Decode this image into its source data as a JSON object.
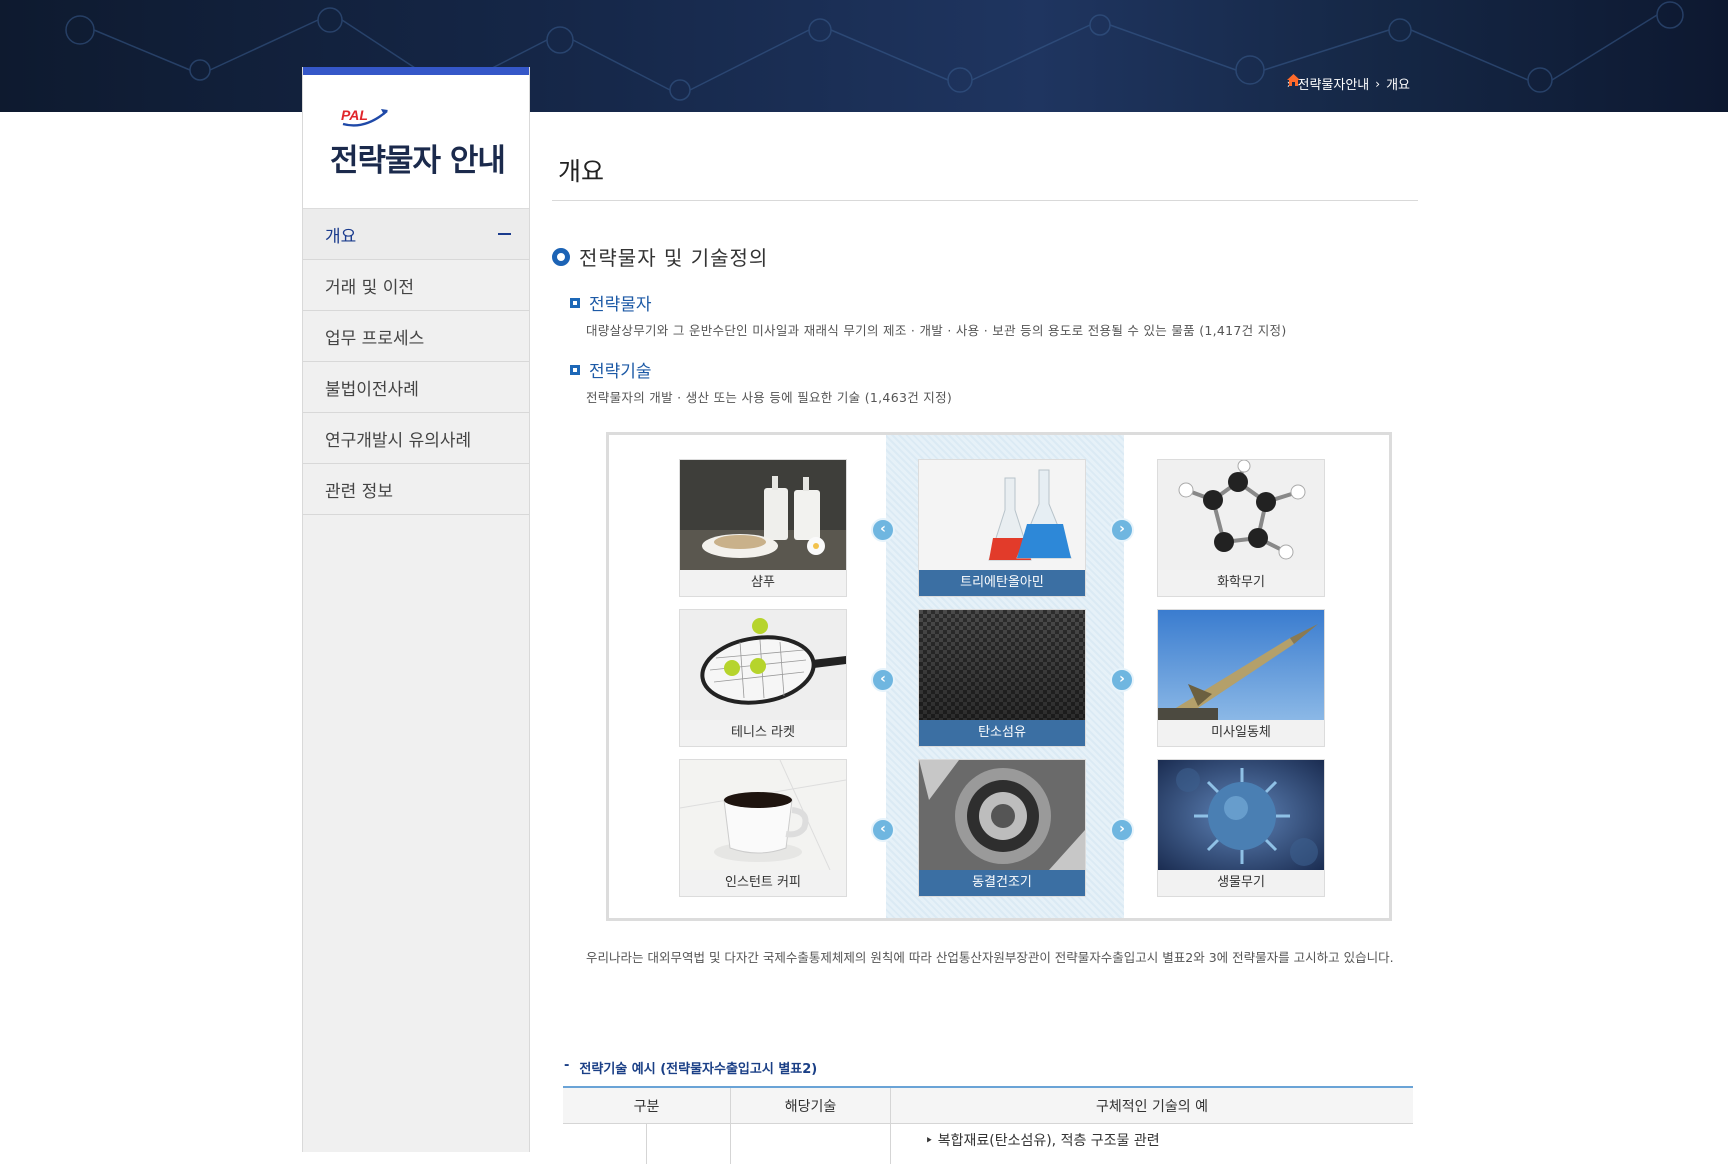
{
  "breadcrumb": {
    "current_section": "전략물자안내",
    "current_page": "개요"
  },
  "sidebar": {
    "logo_text": "PAL",
    "title": "전략물자 안내",
    "items": [
      {
        "label": "개요",
        "active": true
      },
      {
        "label": "거래 및 이전"
      },
      {
        "label": "업무 프로세스"
      },
      {
        "label": "불법이전사례"
      },
      {
        "label": "연구개발시 유의사례"
      },
      {
        "label": "관련 정보"
      }
    ]
  },
  "main": {
    "page_title": "개요",
    "section_title": "전략물자 및 기술정의",
    "sub1": {
      "title": "전략물자",
      "desc": "대량살상무기와 그 운반수단인 미사일과 재래식 무기의 제조 · 개발 · 사용 · 보관 등의 용도로 전용될 수 있는 물품 (1,417건 지정)"
    },
    "sub2": {
      "title": "전략기술",
      "desc": "전략물자의 개발 · 생산 또는 사용 등에 필요한 기술 (1,463건 지정)"
    },
    "gallery": {
      "rows": [
        {
          "left": "샴푸",
          "center": "트리에탄올아민",
          "right": "화학무기"
        },
        {
          "left": "테니스 라켓",
          "center": "탄소섬유",
          "right": "미사일동체"
        },
        {
          "left": "인스턴트 커피",
          "center": "동결건조기",
          "right": "생물무기"
        }
      ],
      "arrow_prev": "‹",
      "arrow_next": "›"
    },
    "paragraph": "우리나라는 대외무역법 및 다자간 국제수출통제체제의 원칙에 따라 산업통산자원부장관이 전략물자수출입고시 별표2와 3에 전략물자를 고시하고 있습니다.",
    "table_section": {
      "dash": "-",
      "title": "전략기술 예시 (전략물자수출입고시 별표2)"
    },
    "table": {
      "headers": [
        "구분",
        "해당기술",
        "구체적인 기술의 예"
      ],
      "first_row_item": "‣ 복합재료(탄소섬유), 적층 구조물 관련"
    }
  },
  "colors": {
    "accent": "#1c63b5",
    "highlight_caption": "#3b6fa3",
    "sidebar_top": "#3557c8"
  }
}
